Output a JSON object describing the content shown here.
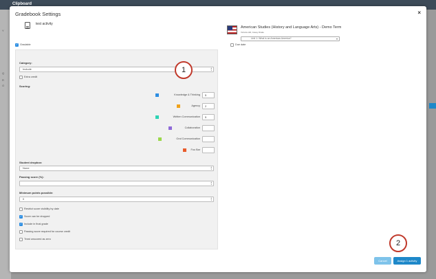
{
  "background": {
    "app_title": "Clipboard",
    "side_items": [
      "Y",
      "Q",
      "R",
      "O"
    ]
  },
  "modal": {
    "title": "Gradebook Settings",
    "close_label": "×"
  },
  "activity": {
    "name": "test activity"
  },
  "course": {
    "title": "American Studies (History and Language Arts) - Demo Term",
    "subtitle": "Victoria Hill, Casey Drake",
    "unit_select": "Unit 1: What is an Americas America?"
  },
  "options": {
    "gradable_label": "Gradable",
    "gradable_checked": true,
    "due_date_label": "Due date",
    "due_date_checked": false
  },
  "settings": {
    "category_label": "Category:",
    "category_value": "Include",
    "extra_credit_label": "Extra credit",
    "scoring_label": "Scoring:",
    "scoring": [
      {
        "label": "Knowledge & Thinking",
        "value": "5",
        "color": "#2d8ee2"
      },
      {
        "label": "Agency",
        "value": "2",
        "color": "#f0a21a"
      },
      {
        "label": "Written Communication",
        "value": "5",
        "color": "#2ed3b4"
      },
      {
        "label": "Collaboration",
        "value": "",
        "color": "#8e6ad8"
      },
      {
        "label": "Oral Communication",
        "value": "",
        "color": "#9bd84a"
      },
      {
        "label": "Foo Bar",
        "value": "",
        "color": "#e85a2a"
      }
    ],
    "dropbox_label": "Student dropbox:",
    "dropbox_value": "None",
    "passing_label": "Passing score (%):",
    "passing_value": "",
    "minpoints_label": "Minimum points possible:",
    "minpoints_value": "0",
    "checkboxes": [
      {
        "label": "Restrict score visibility by date",
        "checked": false
      },
      {
        "label": "Score can be dropped",
        "checked": true
      },
      {
        "label": "Include in final grade",
        "checked": true
      },
      {
        "label": "Passing score required for course credit",
        "checked": false
      },
      {
        "label": "Treat unscored as zero",
        "checked": false
      }
    ]
  },
  "buttons": {
    "cancel": "Cancel",
    "assign": "Assign 1 activity",
    "cancel_color": "#7ec3ea",
    "assign_color": "#1e88c9"
  },
  "callouts": {
    "one": "1",
    "two": "2"
  }
}
